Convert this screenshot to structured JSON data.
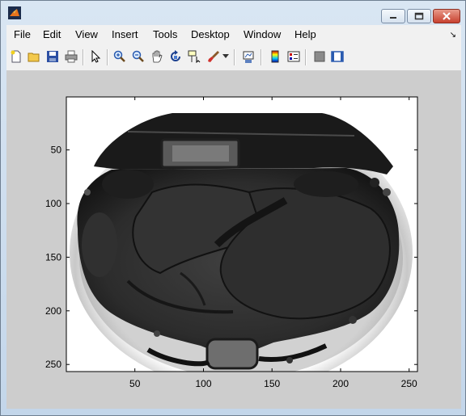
{
  "menu": {
    "items": [
      "File",
      "Edit",
      "View",
      "Insert",
      "Tools",
      "Desktop",
      "Window",
      "Help"
    ]
  },
  "toolbar": {
    "icons": [
      "new-figure-icon",
      "open-file-icon",
      "save-figure-icon",
      "print-figure-icon",
      "edit-plot-icon",
      "zoom-in-icon",
      "zoom-out-icon",
      "pan-icon",
      "rotate-3d-icon",
      "data-cursor-icon",
      "brush-icon",
      "brush-dropdown-icon",
      "link-plot-icon",
      "insert-colorbar-icon",
      "insert-legend-icon",
      "hide-plot-tools-icon",
      "show-plot-tools-icon"
    ]
  },
  "axes": {
    "xticks": [
      "50",
      "100",
      "150",
      "200",
      "250"
    ],
    "yticks": [
      "50",
      "100",
      "150",
      "200",
      "250"
    ]
  },
  "colors": {
    "figure_bg": "#cdcdcd",
    "axes_bg": "#ffffff",
    "close_button": "#c8412f"
  }
}
